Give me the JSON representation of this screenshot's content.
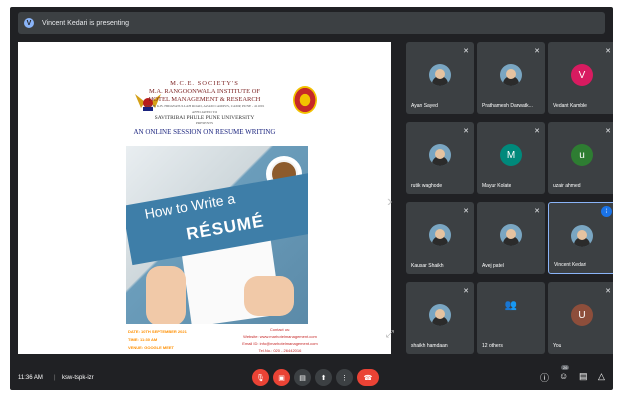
{
  "topbar": {
    "presenter_initial": "V",
    "presenting_text": "Vincent Kedari is presenting"
  },
  "slide": {
    "header_line1": "M.C.E. SOCIETY'S",
    "header_line2": "M.A. RANGOONWALA INSTITUTE OF",
    "header_line3": "HOTEL MANAGEMENT & RESEARCH",
    "header_line4": "2390-B, K.B. HIDAYATULLAH ROAD, AZAM CAMPUS, CAMP, PUNE - 411001",
    "affiliated": "AFFILIATED TO",
    "university": "SAVITRIBAI PHULE PUNE UNIVERSITY",
    "presents": "PRESENTS",
    "session_title": "AN ONLINE SESSION ON RESUME WRITING",
    "photo_title_line1": "How to Write a",
    "photo_title_line2": "RÉSUMÉ",
    "date": "DATE: 10TH SEPTEMBER 2021",
    "time": "TIME: 11:30 AM",
    "venue": "VENUE: GOOGLE MEET",
    "contact_label": "Contact us:",
    "website": "Website: www.marhotelmanagement.com",
    "email": "Email ID: info@marhotelmanagement.com",
    "tel": "Tel.No.: 020 - 26442016"
  },
  "participants": [
    {
      "name": "Ayan Sayed",
      "avatar": "photo"
    },
    {
      "name": "Prathamesh Darwatk...",
      "avatar": "photo"
    },
    {
      "name": "Vedant Kamble",
      "avatar": "V",
      "color": "#d81b60"
    },
    {
      "name": "rutik waghode",
      "avatar": "photo"
    },
    {
      "name": "Mayur Kolate",
      "avatar": "M",
      "color": "#00897b"
    },
    {
      "name": "uzair ahmed",
      "avatar": "u",
      "color": "#2e7d32"
    },
    {
      "name": "Kausar Shaikh",
      "avatar": "photo"
    },
    {
      "name": "Avej patel",
      "avatar": "photo"
    },
    {
      "name": "Vincent Kedari",
      "avatar": "photo"
    },
    {
      "name": "shaikh hamdaan",
      "avatar": "photo"
    },
    {
      "name": "12 others",
      "avatar": "group"
    },
    {
      "name": "You",
      "avatar": "U",
      "color": "#8d4e3b"
    }
  ],
  "bottombar": {
    "time": "11:36 AM",
    "separator": "|",
    "meeting_code": "ksw-tspk-izr",
    "people_count": "26"
  },
  "icons": {
    "mic_off": "mic-off-icon",
    "camera_off": "camera-off-icon",
    "captions": "captions-icon",
    "present": "present-icon",
    "more": "more-icon",
    "end_call": "end-call-icon",
    "info": "info-icon",
    "people": "people-icon",
    "chat": "chat-icon",
    "activities": "activities-icon"
  },
  "colors": {
    "background": "#202124",
    "tile": "#3c4043",
    "accent": "#8ab4f8",
    "red": "#ea4335"
  }
}
